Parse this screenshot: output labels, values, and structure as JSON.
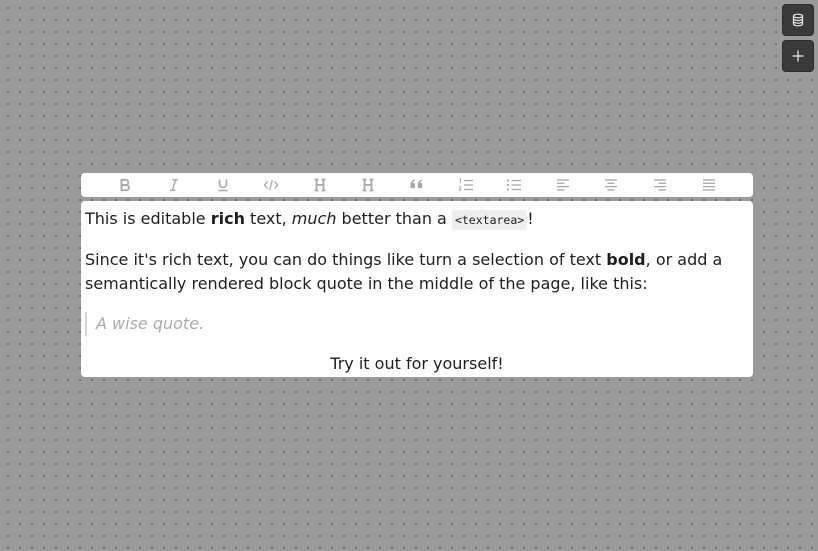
{
  "sidebar_buttons": [
    {
      "name": "database",
      "icon": "database-icon"
    },
    {
      "name": "add",
      "icon": "plus-icon"
    }
  ],
  "toolbar": {
    "items": [
      {
        "action": "bold",
        "icon": "bold-icon"
      },
      {
        "action": "italic",
        "icon": "italic-icon"
      },
      {
        "action": "underline",
        "icon": "underline-icon"
      },
      {
        "action": "code",
        "icon": "code-icon"
      },
      {
        "action": "heading-one",
        "icon": "heading-icon"
      },
      {
        "action": "heading-two",
        "icon": "heading-icon"
      },
      {
        "action": "block-quote",
        "icon": "quote-icon"
      },
      {
        "action": "numbered-list",
        "icon": "numbered-list-icon"
      },
      {
        "action": "bulleted-list",
        "icon": "bulleted-list-icon"
      },
      {
        "action": "align-left",
        "icon": "align-left-icon"
      },
      {
        "action": "align-center",
        "icon": "align-center-icon"
      },
      {
        "action": "align-right",
        "icon": "align-right-icon"
      },
      {
        "action": "align-justify",
        "icon": "align-justify-icon"
      }
    ],
    "icon_color": "#a8a8a8"
  },
  "editor": {
    "p1": {
      "t1": "This is editable ",
      "bold": "rich",
      "t2": " text, ",
      "italic": "much",
      "t3": " better than a ",
      "code": "<textarea>",
      "t4": "!"
    },
    "p2": {
      "t1": "Since it's rich text, you can do things like turn a selection of text ",
      "bold": "bold",
      "t2": ", or add a semantically rendered block quote in the middle of the page, like this:"
    },
    "quote": "A wise quote.",
    "p3": "Try it out for yourself!"
  },
  "colors": {
    "canvas": "#9a9a9a",
    "panel": "#ffffff",
    "text": "#1e1e1e",
    "side_button": "#3a3a3a"
  }
}
